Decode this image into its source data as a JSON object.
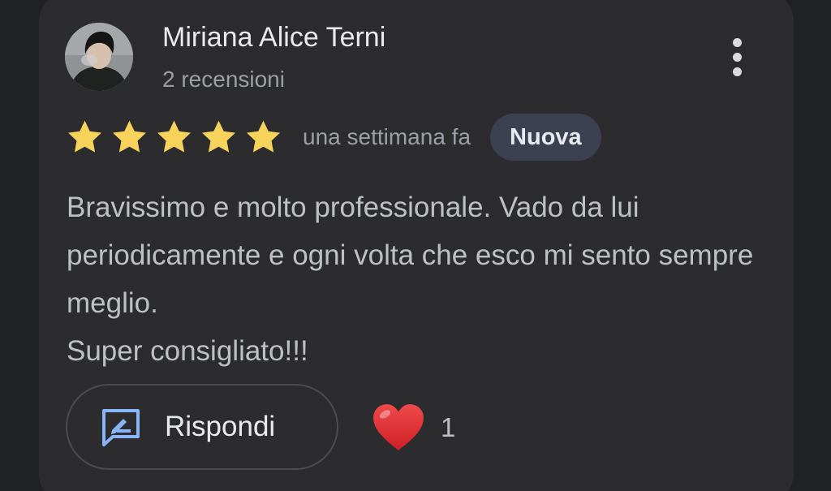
{
  "review": {
    "author": {
      "name": "Miriana Alice Terni",
      "meta": "2 recensioni"
    },
    "rating": 5,
    "time_ago": "una settimana fa",
    "badge": "Nuova",
    "text": "Bravissimo e molto professionale. Vado da lui periodicamente e ogni volta che esco mi sento sempre meglio.\nSuper consigliato!!!",
    "actions": {
      "reply_label": "Rispondi",
      "reaction_count": "1"
    }
  },
  "colors": {
    "background": "#202124",
    "card": "#2c2c2e",
    "star": "#f8d35b",
    "badge_bg": "#3c4152",
    "reply_icon": "#8ab4f8",
    "heart": "#e0242f"
  },
  "icons": {
    "avatar": "user-photo",
    "more": "more-vertical-icon",
    "star": "star-icon",
    "reply": "reply-edit-icon",
    "reaction": "heart-icon"
  }
}
